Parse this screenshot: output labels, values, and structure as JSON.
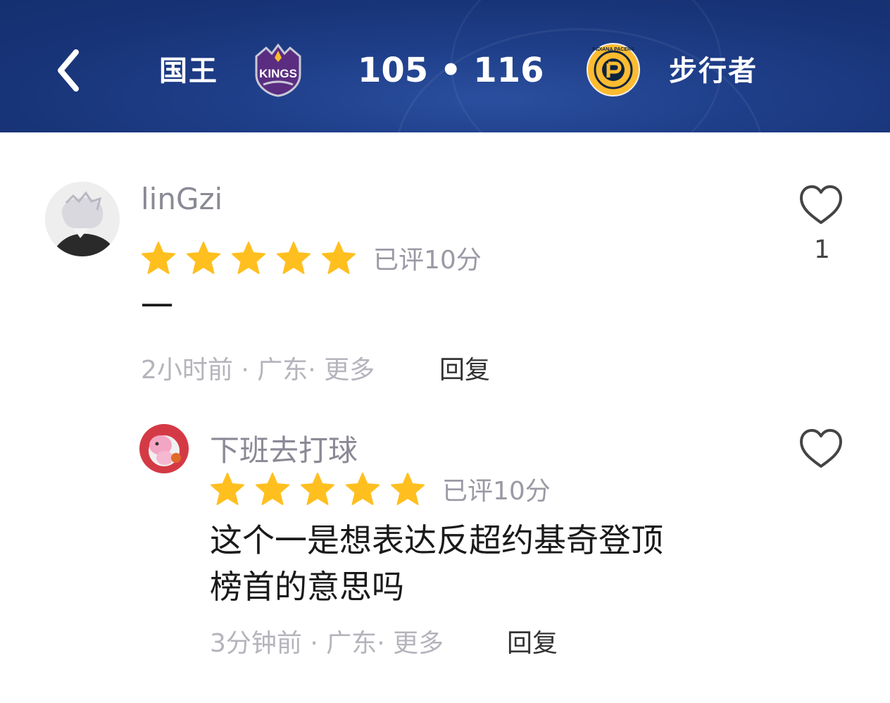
{
  "header": {
    "home_team": "国王",
    "away_team": "步行者",
    "score": "105 • 116",
    "home_logo_text": "KINGS",
    "away_logo_text": "INDIANA PACERS"
  },
  "comments": [
    {
      "username": "linGzi",
      "stars": 5,
      "rating_label": "已评10分",
      "text": "一",
      "meta": "2小时前 · 广东· 更多",
      "reply_label": "回复",
      "likes": "1"
    },
    {
      "username": "下班去打球",
      "stars": 5,
      "rating_label": "已评10分",
      "text_line1": "这个一是想表达反超约基奇登顶",
      "text_line2": "榜首的意思吗",
      "meta": "3分钟前 · 广东· 更多",
      "reply_label": "回复"
    }
  ],
  "icons": {
    "back": "chevron-left-icon",
    "like": "heart-outline-icon",
    "star": "star-filled-icon"
  },
  "colors": {
    "header_bg": "#1b3a80",
    "star": "#ffbf1f",
    "kings_purple": "#5a2d81",
    "pacers_gold": "#fdbb30"
  }
}
